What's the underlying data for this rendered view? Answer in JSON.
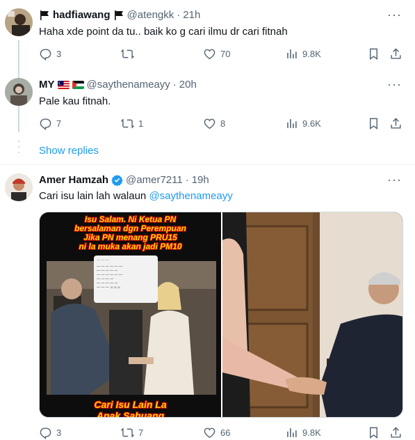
{
  "tweets": [
    {
      "name": "hadfiawang",
      "name_prefix_icon": "black-flag-icon",
      "name_suffix_icon": "black-flag-icon",
      "handle": "@atengkk",
      "separator": "·",
      "time": "21h",
      "text": "Haha xde point da tu.. baik ko g cari ilmu dr cari fitnah",
      "replies": "3",
      "retweets": "",
      "likes": "70",
      "views": "9.8K"
    },
    {
      "name": "MY",
      "name_flags": [
        "malaysia-flag-icon",
        "palestine-flag-icon"
      ],
      "handle": "@saythenameayy",
      "separator": "·",
      "time": "20h",
      "text": "Pale kau fitnah.",
      "replies": "7",
      "retweets": "1",
      "likes": "8",
      "views": "9.6K"
    },
    {
      "name": "Amer Hamzah",
      "verified_icon": "verified-badge-icon",
      "handle": "@amer7211",
      "separator": "·",
      "time": "19h",
      "text": "Cari isu lain lah walaun ",
      "mention": "@saythenameayy",
      "replies": "3",
      "retweets": "7",
      "likes": "66",
      "views": "9.8K",
      "image_caption_top": [
        "Isu Salam. Ni Ketua PN",
        "bersalaman dgn Perempuan",
        "Jika PN menang PRU15",
        "ni la muka akan jadi PM10"
      ],
      "image_caption_bottom": [
        "Cari Isu Lain La",
        "Anak Sahuang"
      ]
    }
  ],
  "show_replies": "Show replies",
  "colors": {
    "link": "#1d9bf0",
    "secondary": "#536471",
    "thread_line": "#cfd9de",
    "divider": "#eff3f4",
    "verified": "#1d9bf0"
  }
}
